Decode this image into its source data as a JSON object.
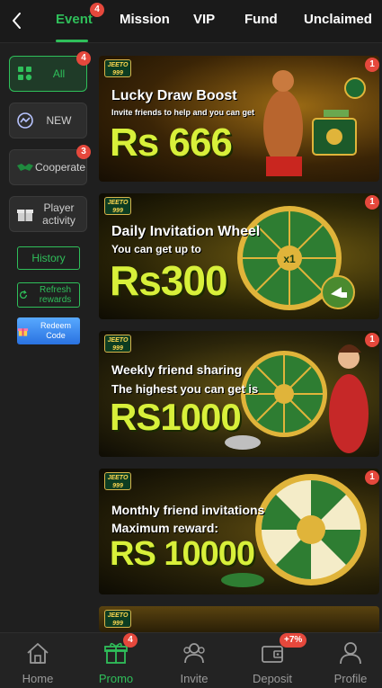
{
  "topbar": {
    "tabs": [
      {
        "label": "Event",
        "badge": "4"
      },
      {
        "label": "Mission"
      },
      {
        "label": "VIP"
      },
      {
        "label": "Fund"
      },
      {
        "label": "Unclaimed"
      }
    ],
    "active_tab": "Event"
  },
  "sidebar": {
    "items": [
      {
        "label": "All",
        "badge": "4",
        "icon": "grid-icon"
      },
      {
        "label": "NEW",
        "icon": "chat-bubble-icon"
      },
      {
        "label": "Cooperate",
        "badge": "3",
        "icon": "handshake-icon"
      },
      {
        "label": "Player activity",
        "icon": "gift-box-icon"
      }
    ],
    "history_label": "History",
    "refresh_label": "Refresh rewards",
    "redeem_label": "Redeem Code"
  },
  "cards": [
    {
      "logo": "JEETO 999",
      "line1": "Lucky Draw Boost",
      "line2": "Invite friends to help and you can get",
      "amount": "Rs 666",
      "badge": "1"
    },
    {
      "logo": "JEETO 999",
      "line1": "Daily Invitation Wheel",
      "line2": "You can get up to",
      "amount": "Rs300",
      "badge": "1"
    },
    {
      "logo": "JEETO 999",
      "line1": "Weekly friend sharing",
      "line2": "The highest you can get is",
      "amount": "RS1000",
      "badge": "1"
    },
    {
      "logo": "JEETO 999",
      "line1": "Monthly friend invitations",
      "line2": "Maximum reward:",
      "amount": "RS 10000",
      "badge": "1"
    },
    {
      "logo": "JEETO 999"
    }
  ],
  "bottomnav": {
    "items": [
      {
        "label": "Home",
        "icon": "home-icon"
      },
      {
        "label": "Promo",
        "icon": "gift-icon",
        "badge": "4"
      },
      {
        "label": "Invite",
        "icon": "people-icon"
      },
      {
        "label": "Deposit",
        "icon": "wallet-icon",
        "badge": "+7%"
      },
      {
        "label": "Profile",
        "icon": "person-icon"
      }
    ],
    "active": "Promo"
  },
  "colors": {
    "accent": "#2fbf5a",
    "badge": "#e5483c",
    "amount": "#d8f03a"
  }
}
